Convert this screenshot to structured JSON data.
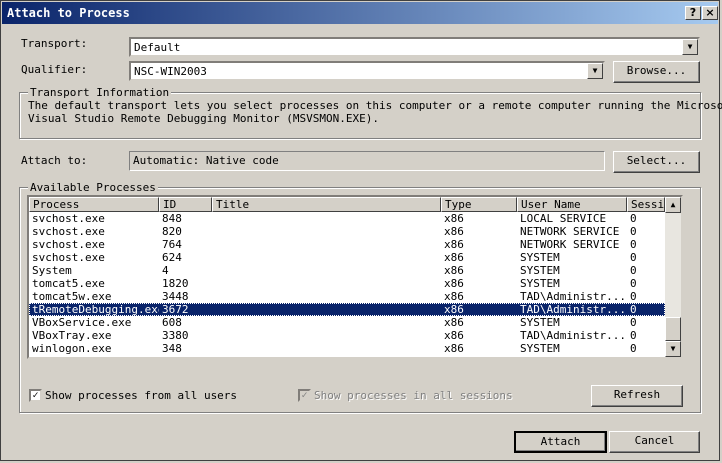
{
  "window": {
    "title": "Attach to Process",
    "help_glyph": "?",
    "close_glyph": "×"
  },
  "transport": {
    "label": "Transport:",
    "value": "Default"
  },
  "qualifier": {
    "label": "Qualifier:",
    "value": "NSC-WIN2003",
    "browse_label": "Browse..."
  },
  "transport_info": {
    "group_title": "Transport Information",
    "line1": "The default transport lets you select processes on this computer or a remote computer running the Microsoft",
    "line2": "Visual Studio Remote Debugging Monitor (MSVSMON.EXE)."
  },
  "attach_to": {
    "label": "Attach to:",
    "value": "Automatic: Native code",
    "select_label": "Select..."
  },
  "available": {
    "group_title": "Available Processes",
    "columns": [
      "Process",
      "ID",
      "Title",
      "Type",
      "User Name",
      "Sessi"
    ],
    "rows": [
      {
        "process": "svchost.exe",
        "id": "848",
        "title": "",
        "type": "x86",
        "user": "LOCAL SERVICE",
        "session": "0"
      },
      {
        "process": "svchost.exe",
        "id": "820",
        "title": "",
        "type": "x86",
        "user": "NETWORK SERVICE",
        "session": "0"
      },
      {
        "process": "svchost.exe",
        "id": "764",
        "title": "",
        "type": "x86",
        "user": "NETWORK SERVICE",
        "session": "0"
      },
      {
        "process": "svchost.exe",
        "id": "624",
        "title": "",
        "type": "x86",
        "user": "SYSTEM",
        "session": "0"
      },
      {
        "process": "System",
        "id": "4",
        "title": "",
        "type": "x86",
        "user": "SYSTEM",
        "session": "0"
      },
      {
        "process": "tomcat5.exe",
        "id": "1820",
        "title": "",
        "type": "x86",
        "user": "SYSTEM",
        "session": "0"
      },
      {
        "process": "tomcat5w.exe",
        "id": "3448",
        "title": "",
        "type": "x86",
        "user": "TAD\\Administr...",
        "session": "0"
      },
      {
        "process": "tRemoteDebugging.exe",
        "id": "3672",
        "title": "",
        "type": "x86",
        "user": "TAD\\Administr...",
        "session": "0"
      },
      {
        "process": "VBoxService.exe",
        "id": "608",
        "title": "",
        "type": "x86",
        "user": "SYSTEM",
        "session": "0"
      },
      {
        "process": "VBoxTray.exe",
        "id": "3380",
        "title": "",
        "type": "x86",
        "user": "TAD\\Administr...",
        "session": "0"
      },
      {
        "process": "winlogon.exe",
        "id": "348",
        "title": "",
        "type": "x86",
        "user": "SYSTEM",
        "session": "0"
      }
    ],
    "selected_index": 7,
    "show_all_users": {
      "label": "Show processes from all users",
      "checked": true
    },
    "show_all_sessions": {
      "label": "Show processes in all sessions",
      "checked": true,
      "disabled": true
    },
    "refresh_label": "Refresh"
  },
  "actions": {
    "attach_label": "Attach",
    "cancel_label": "Cancel"
  },
  "colors": {
    "selection": "#0a246a",
    "face": "#d4d0c8"
  }
}
